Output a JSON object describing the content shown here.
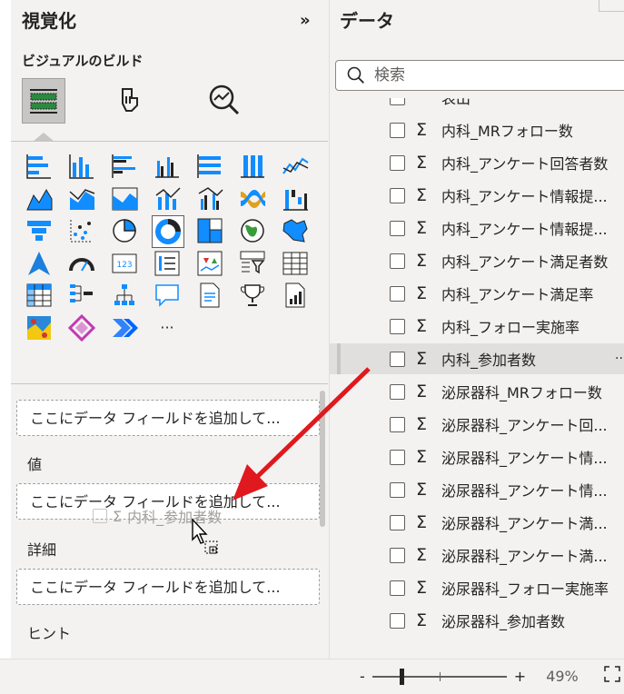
{
  "viz_pane": {
    "title": "視覚化",
    "collapse_icon": "»",
    "build_label": "ビジュアルのビルド",
    "tabs": [
      {
        "name": "build-visual-tab-icon",
        "selected": true
      },
      {
        "name": "format-visual-tab-icon",
        "selected": false
      },
      {
        "name": "analytics-tab-icon",
        "selected": false
      }
    ],
    "visual_types": [
      "stacked-bar-chart",
      "stacked-column-chart",
      "clustered-bar-chart",
      "clustered-column-chart",
      "100-stacked-bar-chart",
      "100-stacked-column-chart",
      "line-chart",
      "area-chart",
      "stacked-area-chart",
      "100-stacked-area-chart",
      "line-and-stacked-column-chart",
      "line-and-clustered-column-chart",
      "ribbon-chart",
      "waterfall-chart",
      "funnel-chart",
      "scatter-chart",
      "pie-chart",
      "donut-chart",
      "treemap",
      "map",
      "filled-map",
      "azure-map",
      "gauge",
      "card",
      "multi-row-card",
      "kpi",
      "slicer",
      "table",
      "matrix",
      "decomposition-tree",
      "key-influencers",
      "qa",
      "narrative",
      "metrics",
      "paginated-report",
      "arcgis-map",
      "power-apps",
      "power-automate",
      "more"
    ],
    "more_label": "···",
    "wells": [
      {
        "label": "",
        "placeholder": "ここにデータ フィールドを追加して..."
      },
      {
        "label": "値",
        "placeholder": "ここにデータ フィールドを追加して..."
      },
      {
        "label": "詳細",
        "placeholder": "ここにデータ フィールドを追加して..."
      },
      {
        "label": "ヒント",
        "placeholder": ""
      }
    ],
    "drag_ghost": "内科_参加者数"
  },
  "data_pane": {
    "title": "データ",
    "search_placeholder": "検索",
    "fields": [
      "表出",
      "内科_MRフォロー数",
      "内科_アンケート回答者数",
      "内科_アンケート情報提...",
      "内科_アンケート情報提...",
      "内科_アンケート満足者数",
      "内科_アンケート満足率",
      "内科_フォロー実施率",
      "内科_参加者数",
      "泌尿器科_MRフォロー数",
      "泌尿器科_アンケート回...",
      "泌尿器科_アンケート情...",
      "泌尿器科_アンケート情...",
      "泌尿器科_アンケート満...",
      "泌尿器科_アンケート満...",
      "泌尿器科_フォロー実施率",
      "泌尿器科_参加者数"
    ],
    "hovered_index": 8,
    "row_more": "···"
  },
  "status_bar": {
    "zoom_minus": "-",
    "zoom_plus": "+",
    "zoom_level": "49%"
  },
  "colors": {
    "accent_blue": "#118dff",
    "arrow_red": "#e0191e",
    "pane_bg": "#f3f2f1"
  }
}
